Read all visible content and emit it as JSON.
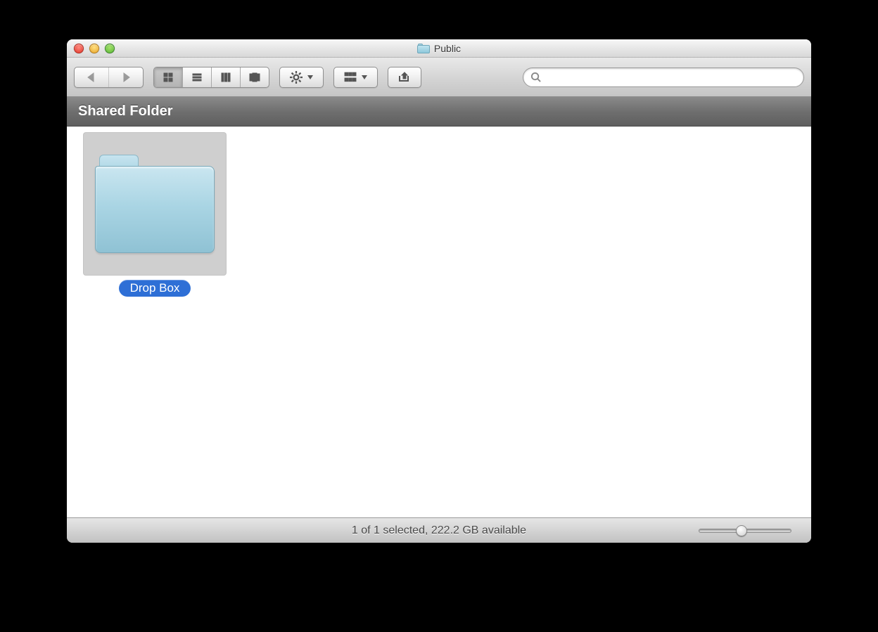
{
  "window": {
    "title": "Public"
  },
  "toolbar": {
    "search_placeholder": ""
  },
  "sharedbar": {
    "label": "Shared Folder"
  },
  "items": [
    {
      "name": "Drop Box",
      "selected": true
    }
  ],
  "statusbar": {
    "text": "1 of 1 selected, 222.2 GB available"
  }
}
